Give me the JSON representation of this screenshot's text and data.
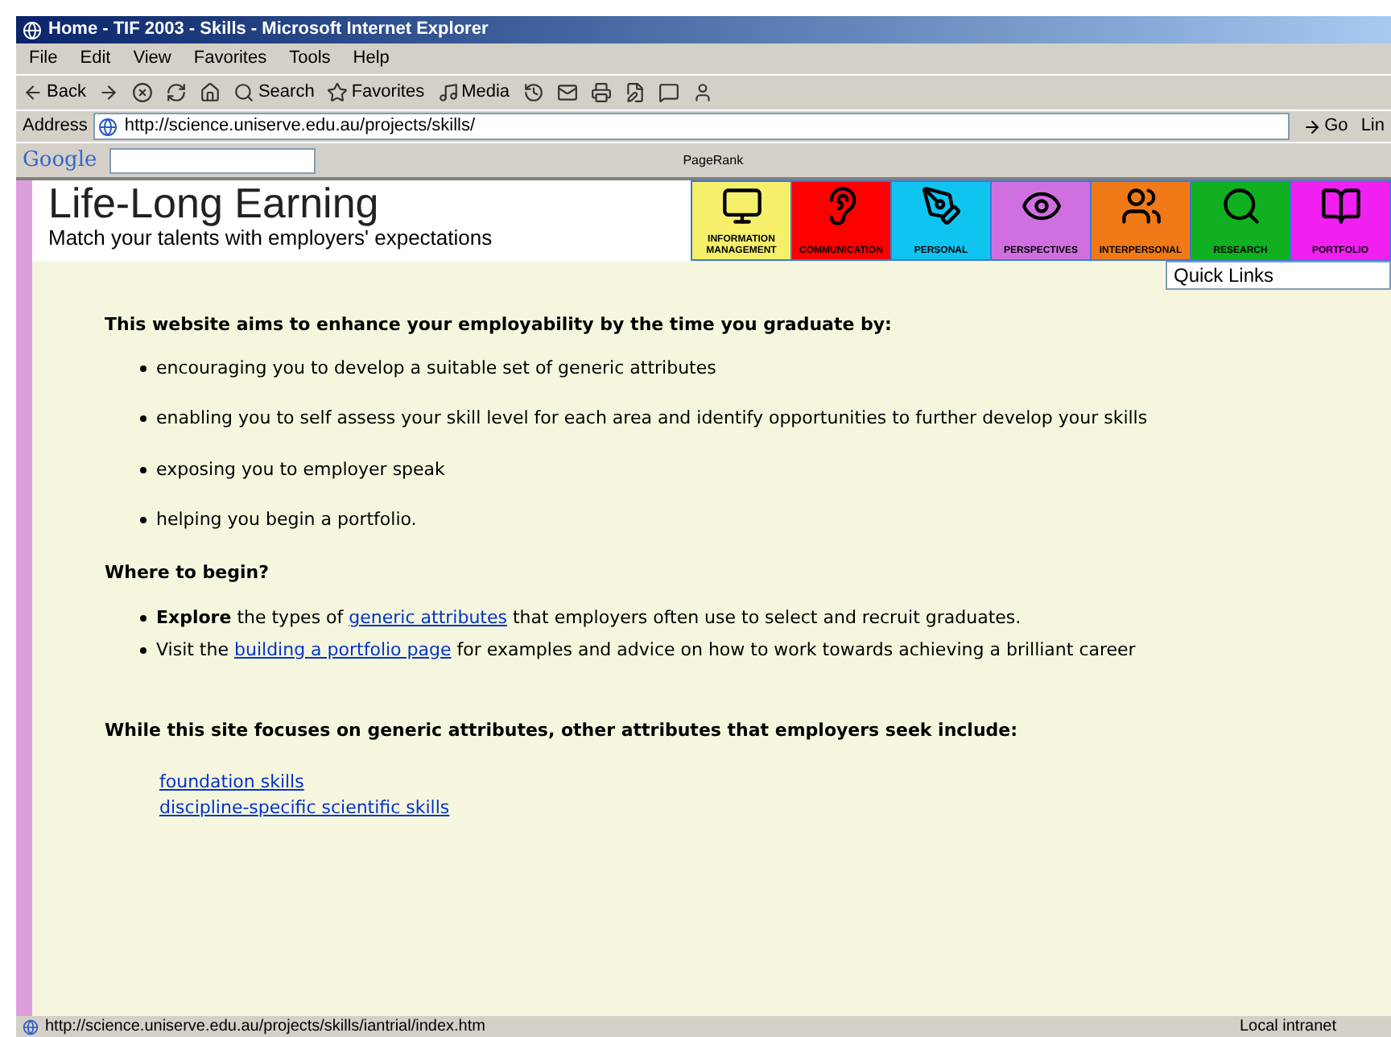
{
  "window": {
    "title": "Home - TIF 2003 - Skills - Microsoft Internet Explorer"
  },
  "menu": [
    "File",
    "Edit",
    "View",
    "Favorites",
    "Tools",
    "Help"
  ],
  "toolbar": [
    {
      "kind": "back",
      "label": "Back"
    },
    {
      "kind": "forward"
    },
    {
      "kind": "stop"
    },
    {
      "kind": "refresh"
    },
    {
      "kind": "home"
    },
    {
      "kind": "search",
      "label": "Search"
    },
    {
      "kind": "favorites",
      "label": "Favorites"
    },
    {
      "kind": "media",
      "label": "Media"
    },
    {
      "kind": "history"
    },
    {
      "kind": "mail"
    },
    {
      "kind": "print"
    },
    {
      "kind": "edit"
    },
    {
      "kind": "discuss"
    },
    {
      "kind": "messenger"
    }
  ],
  "address": {
    "label": "Address",
    "url": "http://science.uniserve.edu.au/projects/skills/",
    "go": "Go",
    "links": "Lin"
  },
  "google_bar": {
    "logo": "Google",
    "pagerank": "PageRank"
  },
  "banner": {
    "title": "Life-Long Earning",
    "subtitle": "Match your talents with employers' expectations"
  },
  "nav": [
    {
      "label": "INFORMATION MANAGEMENT",
      "color": "#f5ef6a",
      "kind": "monitor"
    },
    {
      "label": "COMMUNICATION",
      "color": "#ff0000",
      "kind": "ear"
    },
    {
      "label": "PERSONAL",
      "color": "#10c4f0",
      "kind": "pen"
    },
    {
      "label": "PERSPECTIVES",
      "color": "#d070e0",
      "kind": "eye"
    },
    {
      "label": "INTERPERSONAL",
      "color": "#f07a18",
      "kind": "people"
    },
    {
      "label": "RESEARCH",
      "color": "#10b020",
      "kind": "magnifier"
    },
    {
      "label": "PORTFOLIO",
      "color": "#f020f0",
      "kind": "book"
    }
  ],
  "quick_links": {
    "value": "Quick Links"
  },
  "intro": {
    "heading": "This website aims to enhance your employability by the time you graduate by:",
    "bullets": [
      "encouraging you to develop a suitable set of generic attributes",
      "enabling you to self assess your skill level for each area and identify opportunities to further develop your skills",
      "exposing you to employer speak",
      "helping you begin a portfolio."
    ]
  },
  "begin": {
    "heading": "Where to begin?",
    "items": [
      [
        {
          "kind": "bold",
          "text": "Explore"
        },
        {
          "kind": "text",
          "text": " the types of "
        },
        {
          "kind": "link",
          "text": "generic attributes"
        },
        {
          "kind": "text",
          "text": " that employers often use to select and recruit graduates."
        }
      ],
      [
        {
          "kind": "text",
          "text": "Visit the "
        },
        {
          "kind": "link",
          "text": "building a portfolio page"
        },
        {
          "kind": "text",
          "text": " for examples and advice on how to work towards achieving a brilliant career"
        }
      ]
    ]
  },
  "other": {
    "heading": "While this site focuses on generic attributes, other attributes that employers seek include:",
    "links": [
      "foundation skills",
      "discipline-specific scientific skills"
    ]
  },
  "status_bar": {
    "url": "http://science.uniserve.edu.au/projects/skills/iantrial/index.htm",
    "zone": "Local intranet"
  }
}
